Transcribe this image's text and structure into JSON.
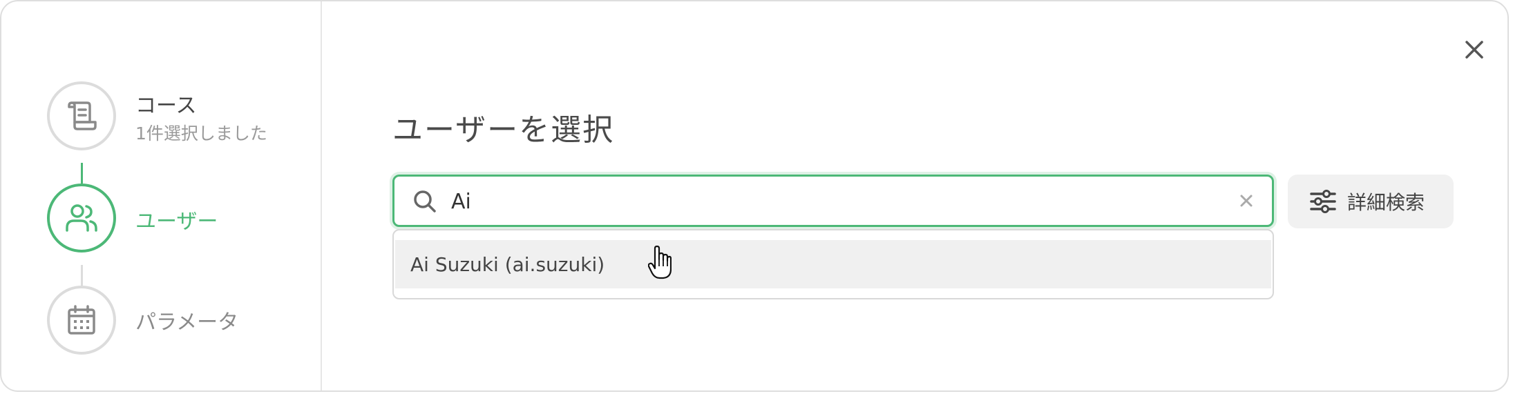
{
  "steps": [
    {
      "title": "コース",
      "subtitle": "1件選択しました",
      "icon": "document-icon",
      "state": "done"
    },
    {
      "title": "ユーザー",
      "icon": "users-icon",
      "state": "active"
    },
    {
      "title": "パラメータ",
      "icon": "calendar-icon",
      "state": "inactive"
    }
  ],
  "main": {
    "title": "ユーザーを選択"
  },
  "search": {
    "value": "Ai",
    "icon": "search-icon",
    "clear_icon": "clear-icon"
  },
  "results": [
    {
      "label": "Ai Suzuki (ai.suzuki)"
    }
  ],
  "advanced_search": {
    "label": "詳細検索",
    "icon": "sliders-icon"
  },
  "close_icon": "close-icon",
  "colors": {
    "accent": "#4cb877",
    "border": "#dcdcdc",
    "text": "#444444",
    "muted": "#9a9a9a",
    "button_bg": "#f1f1f1",
    "highlight_bg": "#f0f0f0"
  }
}
